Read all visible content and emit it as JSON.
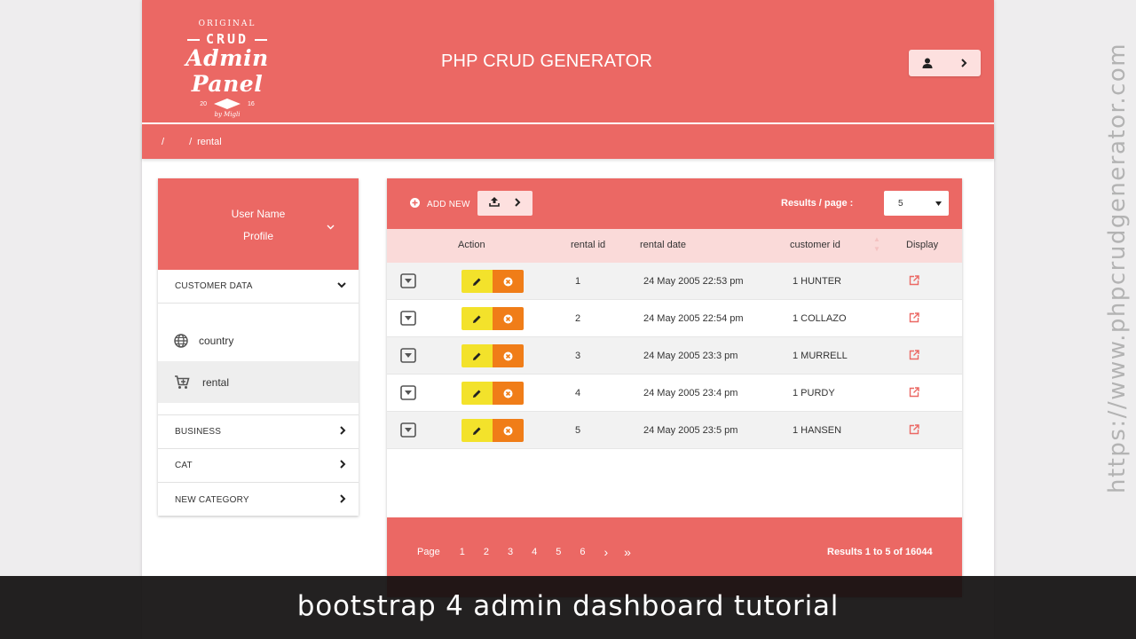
{
  "logo": {
    "top_text": "ORIGINAL",
    "crud_text": "CRUD",
    "main_text": "Admin Panel",
    "year_left": "20",
    "year_right": "16",
    "by_text": "by Migli"
  },
  "header": {
    "title": "PHP CRUD GENERATOR",
    "user_icon": "user-icon",
    "arrow_icon": "chevron-right-icon"
  },
  "breadcrumb": {
    "sep1": "/",
    "sep2": "/",
    "current": "rental"
  },
  "sidebar": {
    "user_name": "User Name",
    "profile_label": "Profile",
    "categories": [
      {
        "label": "CUSTOMER DATA",
        "expanded": true
      },
      {
        "label": "BUSINESS",
        "expanded": false
      },
      {
        "label": "CAT",
        "expanded": false
      },
      {
        "label": "NEW CATEGORY",
        "expanded": false
      }
    ],
    "items": [
      {
        "label": "country",
        "icon": "globe-icon"
      },
      {
        "label": "rental",
        "icon": "cart-icon",
        "active": true
      }
    ]
  },
  "toolbar": {
    "add_new_label": "ADD NEW",
    "results_per_page_label": "Results / page :",
    "results_per_page_value": "5"
  },
  "table": {
    "headers": {
      "action": "Action",
      "rental_id": "rental id",
      "rental_date": "rental date",
      "customer_id": "customer id",
      "display": "Display"
    },
    "rows": [
      {
        "rental_id": "1",
        "rental_date": "24 May 2005 22:53 pm",
        "customer_id": "1 HUNTER"
      },
      {
        "rental_id": "2",
        "rental_date": "24 May 2005 22:54 pm",
        "customer_id": "1 COLLAZO"
      },
      {
        "rental_id": "3",
        "rental_date": "24 May 2005 23:3 pm",
        "customer_id": "1 MURRELL"
      },
      {
        "rental_id": "4",
        "rental_date": "24 May 2005 23:4 pm",
        "customer_id": "1 PURDY"
      },
      {
        "rental_id": "5",
        "rental_date": "24 May 2005 23:5 pm",
        "customer_id": "1 HANSEN"
      }
    ]
  },
  "pagination": {
    "label": "Page",
    "pages": [
      "1",
      "2",
      "3",
      "4",
      "5",
      "6"
    ],
    "next": "›",
    "last": "»",
    "results_text": "Results 1 to 5 of 16044"
  },
  "caption": "bootstrap 4 admin dashboard tutorial",
  "watermark": "https://www.phpcrudgenerator.com",
  "colors": {
    "brand": "#eb6864",
    "header_light": "#fadad9",
    "edit_button": "#f3e22b",
    "delete_button": "#f07d18"
  }
}
